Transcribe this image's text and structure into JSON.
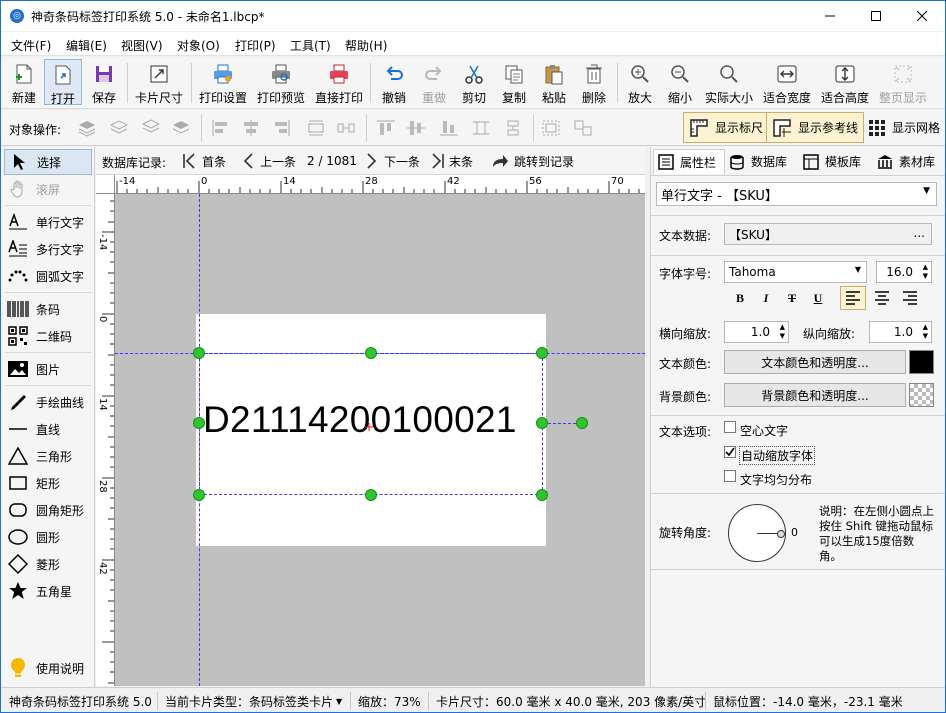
{
  "window": {
    "title": "神奇条码标签打印系统 5.0 - 未命名1.lbcp*"
  },
  "menu": [
    "文件(F)",
    "编辑(E)",
    "视图(V)",
    "对象(O)",
    "打印(P)",
    "工具(T)",
    "帮助(H)"
  ],
  "toolbar": {
    "new": "新建",
    "open": "打开",
    "save": "保存",
    "card_size": "卡片尺寸",
    "print_setup": "打印设置",
    "print_preview": "打印预览",
    "direct_print": "直接打印",
    "undo": "撤销",
    "redo": "重做",
    "cut": "剪切",
    "copy": "复制",
    "paste": "粘贴",
    "delete": "删除",
    "zoom_in": "放大",
    "zoom_out": "缩小",
    "actual_size": "实际大小",
    "fit_width": "适合宽度",
    "fit_height": "适合高度",
    "fit_page": "整页显示"
  },
  "objbar": {
    "label": "对象操作:",
    "show_ruler": "显示标尺",
    "show_guides": "显示参考线",
    "show_grid": "显示网格"
  },
  "tools": {
    "select": "选择",
    "scroll": "滚屏",
    "single_text": "单行文字",
    "multi_text": "多行文字",
    "arc_text": "圆弧文字",
    "barcode": "条码",
    "qrcode": "二维码",
    "image": "图片",
    "freehand": "手绘曲线",
    "line": "直线",
    "triangle": "三角形",
    "rect": "矩形",
    "round_rect": "圆角矩形",
    "circle": "圆形",
    "diamond": "菱形",
    "star": "五角星",
    "help": "使用说明"
  },
  "records": {
    "label": "数据库记录:",
    "first": "首条",
    "prev": "上一条",
    "position": "2 / 1081",
    "next": "下一条",
    "last": "末条",
    "jump": "跳转到记录"
  },
  "ruler": {
    "h_ticks": [
      "-14",
      "0",
      "14",
      "28",
      "42",
      "56",
      "70"
    ],
    "v_ticks": [
      "-14",
      "0",
      "14",
      "28",
      "42"
    ]
  },
  "canvas": {
    "text": "D21114200100021"
  },
  "panel": {
    "tabs": [
      "属性栏",
      "数据库",
      "模板库",
      "素材库"
    ],
    "object_type": "单行文字 - 【SKU】",
    "text_data_label": "文本数据:",
    "text_data": "【SKU】",
    "more": "...",
    "font_label": "字体字号:",
    "font": "Tahoma",
    "font_size": "16.0",
    "bold": "B",
    "italic": "I",
    "strike": "T",
    "underline": "U",
    "hscale_label": "横向缩放:",
    "hscale": "1.0",
    "vscale_label": "纵向缩放:",
    "vscale": "1.0",
    "text_color_label": "文本颜色:",
    "text_color_btn": "文本颜色和透明度...",
    "bg_color_label": "背景颜色:",
    "bg_color_btn": "背景颜色和透明度...",
    "options_label": "文本选项:",
    "hollow": "空心文字",
    "auto_shrink": "自动缩放字体",
    "even": "文字均匀分布",
    "rotation_label": "旋转角度:",
    "rotation_value": "0",
    "rotation_hint": "说明：在左侧小圆点上按住 Shift 键拖动鼠标可以生成15度倍数角。"
  },
  "status": {
    "app": "神奇条码标签打印系统 5.0",
    "card_type": "当前卡片类型：条码标签类卡片",
    "zoom": "缩放：73%",
    "card_size": "卡片尺寸：60.0 毫米 x 40.0 毫米, 203 像素/英寸",
    "mouse": "鼠标位置：-14.0 毫米，-23.1 毫米"
  },
  "colors": {
    "accent": "#1f6fd0",
    "handle": "#2ec52e",
    "guide": "#3b3bff",
    "canvas_bg": "#c0c0c0"
  }
}
